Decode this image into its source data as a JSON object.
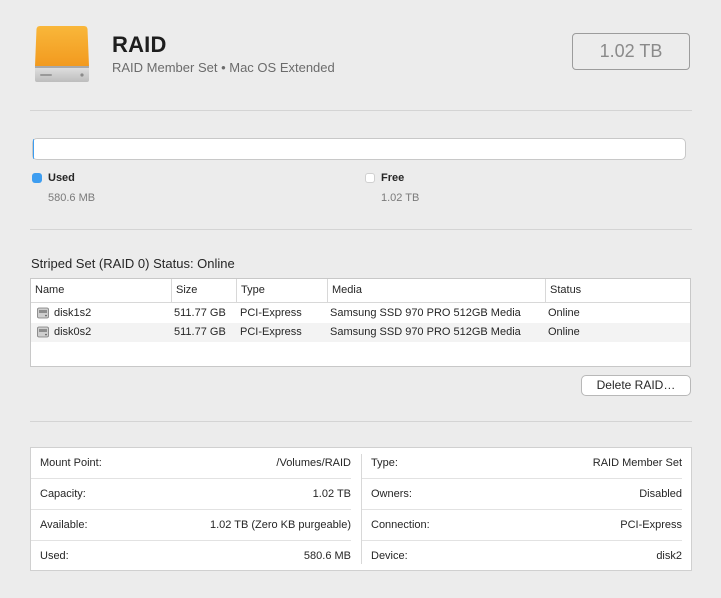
{
  "header": {
    "title": "RAID",
    "subtitle": "RAID Member Set • Mac OS Extended",
    "capacity": "1.02 TB",
    "icon": "external-drive-icon"
  },
  "usage": {
    "used_fraction": 0.0006,
    "used_label": "Used",
    "used_value": "580.6 MB",
    "free_label": "Free",
    "free_value": "1.02 TB",
    "used_color": "#3d9df0",
    "free_color": "#ffffff"
  },
  "raid": {
    "status_text": "Striped Set (RAID 0) Status: Online",
    "columns": [
      "Name",
      "Size",
      "Type",
      "Media",
      "Status"
    ],
    "rows": [
      {
        "name": "disk1s2",
        "size": "511.77 GB",
        "type": "PCI-Express",
        "media": "Samsung SSD 970 PRO 512GB Media",
        "status": "Online"
      },
      {
        "name": "disk0s2",
        "size": "511.77 GB",
        "type": "PCI-Express",
        "media": "Samsung SSD 970 PRO 512GB Media",
        "status": "Online"
      }
    ],
    "delete_button": "Delete RAID…"
  },
  "info": {
    "left": [
      {
        "key": "Mount Point:",
        "value": "/Volumes/RAID"
      },
      {
        "key": "Capacity:",
        "value": "1.02 TB"
      },
      {
        "key": "Available:",
        "value": "1.02 TB (Zero KB purgeable)"
      },
      {
        "key": "Used:",
        "value": "580.6 MB"
      }
    ],
    "right": [
      {
        "key": "Type:",
        "value": "RAID Member Set"
      },
      {
        "key": "Owners:",
        "value": "Disabled"
      },
      {
        "key": "Connection:",
        "value": "PCI-Express"
      },
      {
        "key": "Device:",
        "value": "disk2"
      }
    ]
  }
}
